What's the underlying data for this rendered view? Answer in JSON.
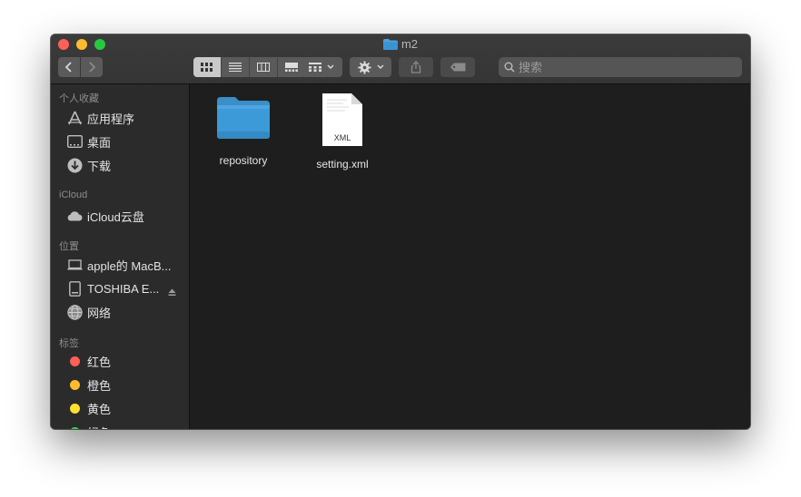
{
  "window": {
    "title": "m2"
  },
  "toolbar": {
    "back_icon": "chevron-left-icon",
    "forward_icon": "chevron-right-icon",
    "view_modes": [
      "icon-view",
      "list-view",
      "column-view",
      "gallery-view"
    ],
    "active_view": "icon-view",
    "search_placeholder": "搜索"
  },
  "sidebar": {
    "favorites_title": "个人收藏",
    "favorites": [
      {
        "label": "应用程序",
        "icon": "applications-icon"
      },
      {
        "label": "桌面",
        "icon": "desktop-icon"
      },
      {
        "label": "下载",
        "icon": "downloads-icon"
      }
    ],
    "icloud_title": "iCloud",
    "icloud": [
      {
        "label": "iCloud云盘",
        "icon": "cloud-icon"
      }
    ],
    "locations_title": "位置",
    "locations": [
      {
        "label": "apple的 MacB...",
        "icon": "laptop-icon"
      },
      {
        "label": "TOSHIBA E...",
        "icon": "external-drive-icon"
      },
      {
        "label": "网络",
        "icon": "network-icon"
      }
    ],
    "tags_title": "标签",
    "tags": [
      {
        "label": "红色",
        "color": "#fe5f57"
      },
      {
        "label": "橙色",
        "color": "#febc2e"
      },
      {
        "label": "黄色",
        "color": "#fee12e"
      },
      {
        "label": "绿色",
        "color": "#32d74b"
      }
    ]
  },
  "files": [
    {
      "name": "repository",
      "type": "folder"
    },
    {
      "name": "setting.xml",
      "type": "xml",
      "badge": "XML"
    }
  ]
}
